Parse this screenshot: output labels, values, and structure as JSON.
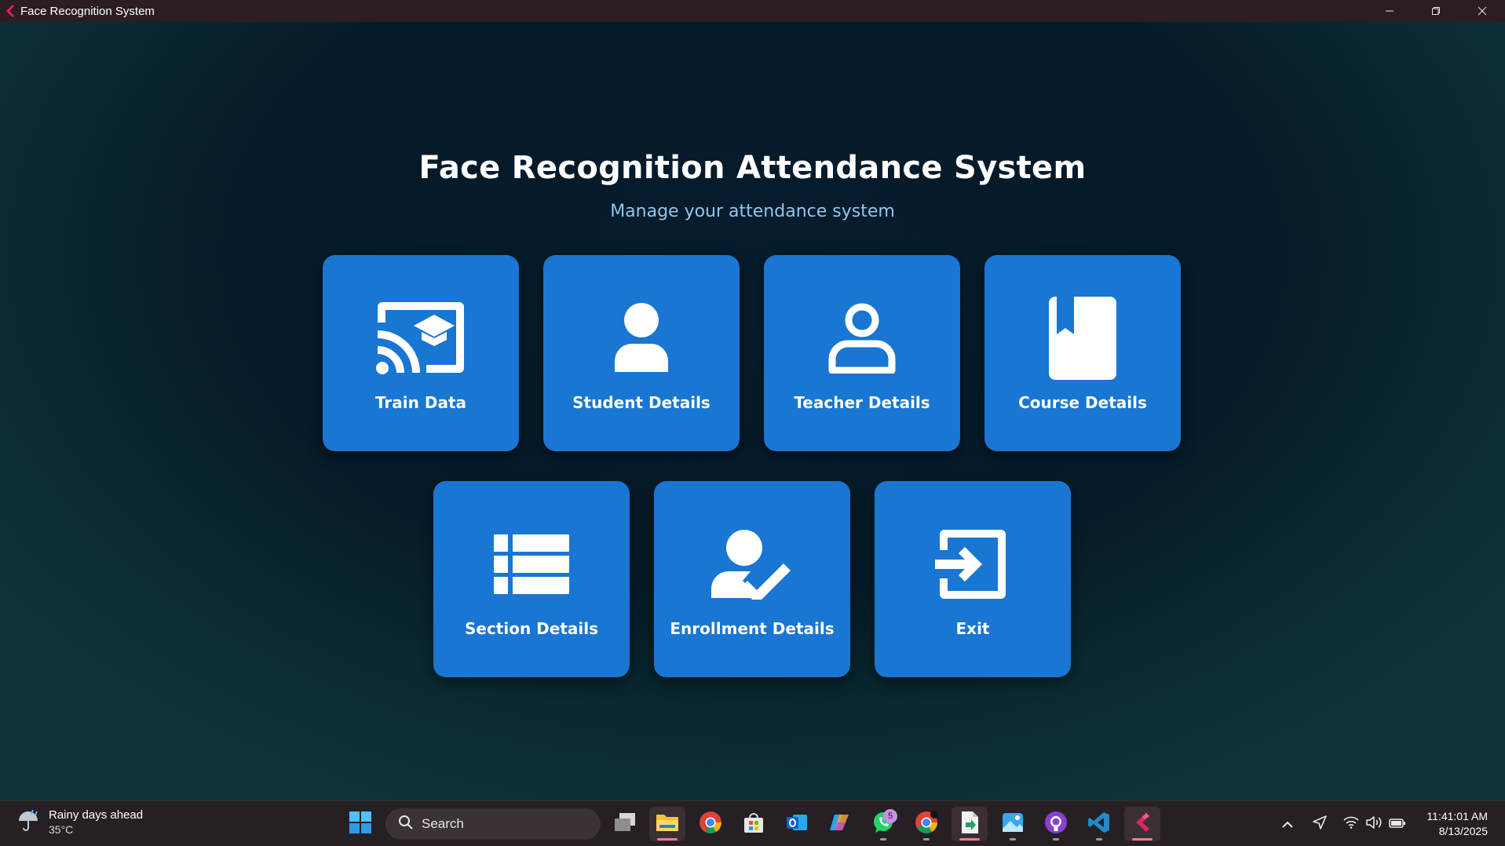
{
  "window": {
    "title": "Face Recognition System",
    "controls": [
      "minimize",
      "restore",
      "close"
    ]
  },
  "main": {
    "heading": "Face Recognition Attendance System",
    "subheading": "Manage your attendance system",
    "card_color": "#1976d2",
    "cards": [
      {
        "label": "Train Data",
        "icon": "train-data-icon"
      },
      {
        "label": "Student Details",
        "icon": "student-icon"
      },
      {
        "label": "Teacher Details",
        "icon": "teacher-icon"
      },
      {
        "label": "Course Details",
        "icon": "course-book-icon"
      },
      {
        "label": "Section Details",
        "icon": "section-list-icon"
      },
      {
        "label": "Enrollment Details",
        "icon": "enrollment-icon"
      },
      {
        "label": "Exit",
        "icon": "exit-icon"
      }
    ]
  },
  "taskbar": {
    "weather": {
      "condition": "Rainy days ahead",
      "temperature": "35°C",
      "icon": "umbrella-rain-icon"
    },
    "search_label": "Search",
    "apps": [
      {
        "name": "start-button",
        "icon": "windows-icon"
      },
      {
        "name": "task-view",
        "icon": "task-view-icon"
      },
      {
        "name": "file-explorer",
        "icon": "folder-icon",
        "state": "open"
      },
      {
        "name": "chrome",
        "icon": "chrome-icon"
      },
      {
        "name": "microsoft-store",
        "icon": "store-icon"
      },
      {
        "name": "outlook",
        "icon": "outlook-icon"
      },
      {
        "name": "copilot",
        "icon": "copilot-icon"
      },
      {
        "name": "whatsapp",
        "icon": "whatsapp-icon",
        "badge": "5"
      },
      {
        "name": "chrome-profile",
        "icon": "chrome-icon"
      },
      {
        "name": "file-app",
        "icon": "document-icon",
        "state": "open"
      },
      {
        "name": "photos",
        "icon": "photos-icon"
      },
      {
        "name": "github-desktop",
        "icon": "github-icon"
      },
      {
        "name": "vscode",
        "icon": "vscode-icon"
      },
      {
        "name": "face-recognition-app",
        "icon": "app-logo-icon",
        "state": "active"
      }
    ],
    "tray_icons": [
      "chevron-up-icon",
      "location-icon",
      "wifi-icon",
      "volume-icon",
      "battery-icon"
    ],
    "time": "11:41:01 AM",
    "date": "8/13/2025"
  }
}
